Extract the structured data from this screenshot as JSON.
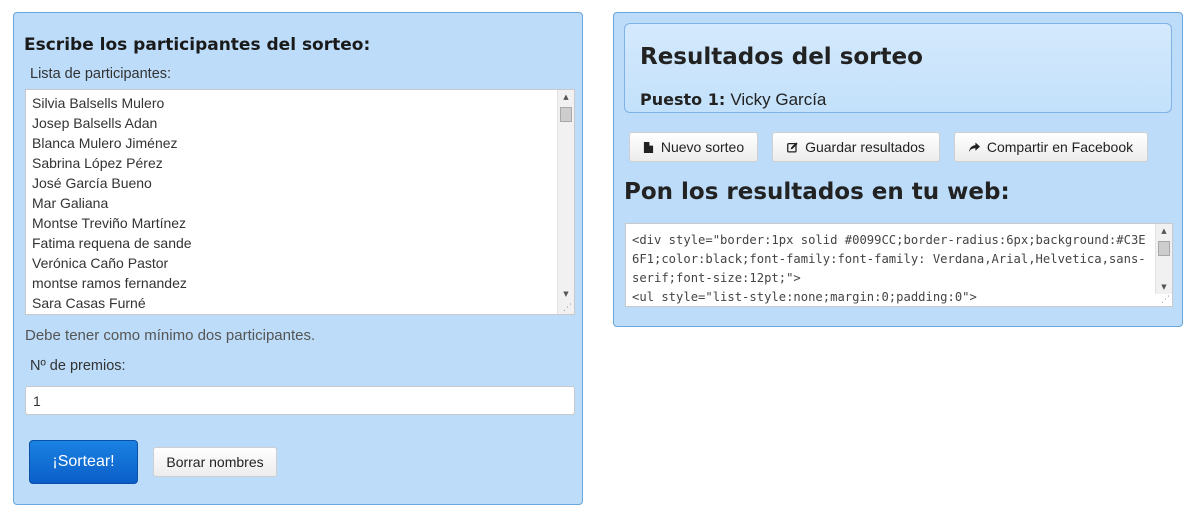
{
  "left": {
    "heading": "Escribe los participantes del sorteo:",
    "list_label": "Lista de participantes:",
    "participants": [
      "Silvia Balsells Mulero",
      "Josep Balsells Adan",
      "Blanca Mulero Jiménez",
      "Sabrina López Pérez",
      "José García Bueno",
      "Mar Galiana",
      "Montse Treviño Martínez",
      "Fatima requena de sande",
      "Verónica Caño Pastor",
      "montse ramos fernandez",
      "Sara Casas Furné"
    ],
    "warning": "Debe tener como mínimo dos participantes.",
    "prizes_label": "Nº de premios:",
    "prizes_value": "1",
    "draw_button": "¡Sortear!",
    "clear_button": "Borrar nombres"
  },
  "right": {
    "results_title": "Resultados del sorteo",
    "result_place": "Puesto 1:",
    "result_name": "Vicky García",
    "buttons": {
      "new": "Nuevo sorteo",
      "save": "Guardar resultados",
      "share": "Compartir en Facebook"
    },
    "embed_heading": "Pon los resultados en tu web:",
    "embed_code": "<div style=\"border:1px solid #0099CC;border-radius:6px;background:#C3E6F1;color:black;font-family:font-family: Verdana,Arial,Helvetica,sans-serif;font-size:12pt;\">\n<ul style=\"list-style:none;margin:0;padding:0\">"
  },
  "colors": {
    "panel_bg": "#bcdcf9",
    "panel_border": "#6aa7dd",
    "primary_button": "#0b5ec8"
  },
  "icons": [
    "file-icon",
    "edit-icon",
    "share-icon",
    "scroll-up-arrow-icon",
    "scroll-down-arrow-icon",
    "resize-grip-icon"
  ]
}
